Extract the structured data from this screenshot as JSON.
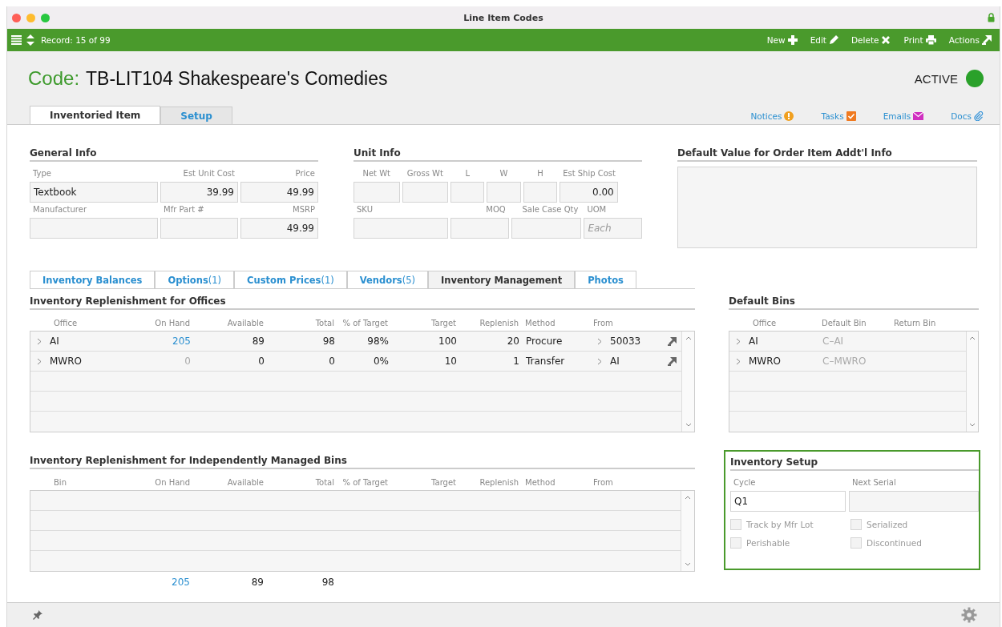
{
  "window": {
    "title": "Line Item Codes"
  },
  "toolbar": {
    "record": "Record: 15 of 99",
    "actions": [
      {
        "label": "New",
        "kind": "new"
      },
      {
        "label": "Edit",
        "kind": "edit"
      },
      {
        "label": "Delete",
        "kind": "delete"
      },
      {
        "label": "Print",
        "kind": "print"
      },
      {
        "label": "Actions",
        "kind": "actions"
      }
    ]
  },
  "header": {
    "code_label": "Code:",
    "code_value": "TB-LIT104 Shakespeare's Comedies",
    "status": {
      "label": "ACTIVE",
      "active": true
    }
  },
  "tabs": [
    {
      "label": "Inventoried Item",
      "selected": true
    },
    {
      "label": "Setup",
      "selected": false
    }
  ],
  "links": [
    {
      "label": "Notices",
      "kind": "notices"
    },
    {
      "label": "Tasks",
      "kind": "tasks"
    },
    {
      "label": "Emails",
      "kind": "emails"
    },
    {
      "label": "Docs",
      "kind": "docs"
    }
  ],
  "general_info": {
    "title": "General Info",
    "rows": [
      [
        {
          "label": "Type",
          "value": "Textbook",
          "kind": "text"
        },
        {
          "label": "Est Unit Cost",
          "value": "39.99",
          "kind": "number"
        },
        {
          "label": "Price",
          "value": "49.99",
          "kind": "number"
        }
      ],
      [
        {
          "label": "Manufacturer",
          "kind": "text"
        },
        {
          "label": "Mfr Part #",
          "kind": "text"
        },
        {
          "label": "MSRP",
          "value": "49.99",
          "kind": "number"
        }
      ]
    ]
  },
  "unit_info": {
    "title": "Unit Info",
    "fields": [
      {
        "label": "Net Wt",
        "kind": "measure"
      },
      {
        "label": "Gross Wt",
        "kind": "measure"
      },
      {
        "label": "L",
        "kind": "measure"
      },
      {
        "label": "W",
        "kind": "measure"
      },
      {
        "label": "H",
        "kind": "measure"
      },
      {
        "label": "Est Ship Cost",
        "value": "0.00",
        "kind": "number"
      },
      {
        "label": "SKU",
        "kind": "text"
      },
      {
        "label": "MOQ",
        "kind": "number"
      },
      {
        "label": "Sale Case Qty",
        "kind": "number"
      },
      {
        "label": "UOM",
        "placeholder": "Each",
        "kind": "text"
      }
    ]
  },
  "addtl_info": {
    "title": "Default Value for Order Item Addt'l Info"
  },
  "sub_tabs": [
    {
      "label": "Inventory Balances",
      "selected": false
    },
    {
      "label": "Options",
      "count": "(1)",
      "selected": false
    },
    {
      "label": "Custom Prices",
      "count": "(1)",
      "selected": false
    },
    {
      "label": "Vendors",
      "count": "(5)",
      "selected": false
    },
    {
      "label": "Inventory Management",
      "selected": true
    },
    {
      "label": "Photos",
      "selected": false
    }
  ],
  "office_replenishment": {
    "title": "Inventory Replenishment for Offices",
    "columns": [
      "Office",
      "On Hand",
      "Available",
      "Total",
      "% of Target",
      "Target",
      "Replenish",
      "Method",
      "From"
    ],
    "rows": [
      {
        "office": "AI",
        "on_hand": "205",
        "on_hand_is_link": true,
        "available": "89",
        "total": "98",
        "pct_target": "98%",
        "target": "100",
        "replenish": "20",
        "method": "Procure",
        "from": "50033"
      },
      {
        "office": "MWRO",
        "on_hand": "0",
        "on_hand_is_link": false,
        "available": "0",
        "total": "0",
        "pct_target": "0%",
        "target": "10",
        "replenish": "1",
        "method": "Transfer",
        "from": "AI"
      }
    ]
  },
  "default_bins": {
    "title": "Default Bins",
    "columns": [
      "Office",
      "Default Bin",
      "Return Bin"
    ],
    "rows": [
      {
        "office": "AI",
        "default_bin": "C–AI"
      },
      {
        "office": "MWRO",
        "default_bin": "C–MWRO"
      }
    ]
  },
  "bin_replenishment": {
    "title": "Inventory Replenishment for Independently Managed Bins",
    "columns": [
      "Bin",
      "On Hand",
      "Available",
      "Total",
      "% of Target",
      "Target",
      "Replenish",
      "Method",
      "From"
    ],
    "totals": {
      "on_hand": "205",
      "available": "89",
      "total": "98"
    }
  },
  "inventory_setup": {
    "title": "Inventory Setup",
    "cycle": {
      "label": "Cycle",
      "value": "Q1"
    },
    "next_serial": {
      "label": "Next Serial"
    },
    "checkboxes": [
      {
        "label": "Track by Mfr Lot",
        "checked": false,
        "disabled": true
      },
      {
        "label": "Serialized",
        "checked": false,
        "disabled": true
      },
      {
        "label": "Perishable",
        "checked": false,
        "disabled": true
      },
      {
        "label": "Discontinued",
        "checked": false,
        "disabled": true
      }
    ]
  }
}
